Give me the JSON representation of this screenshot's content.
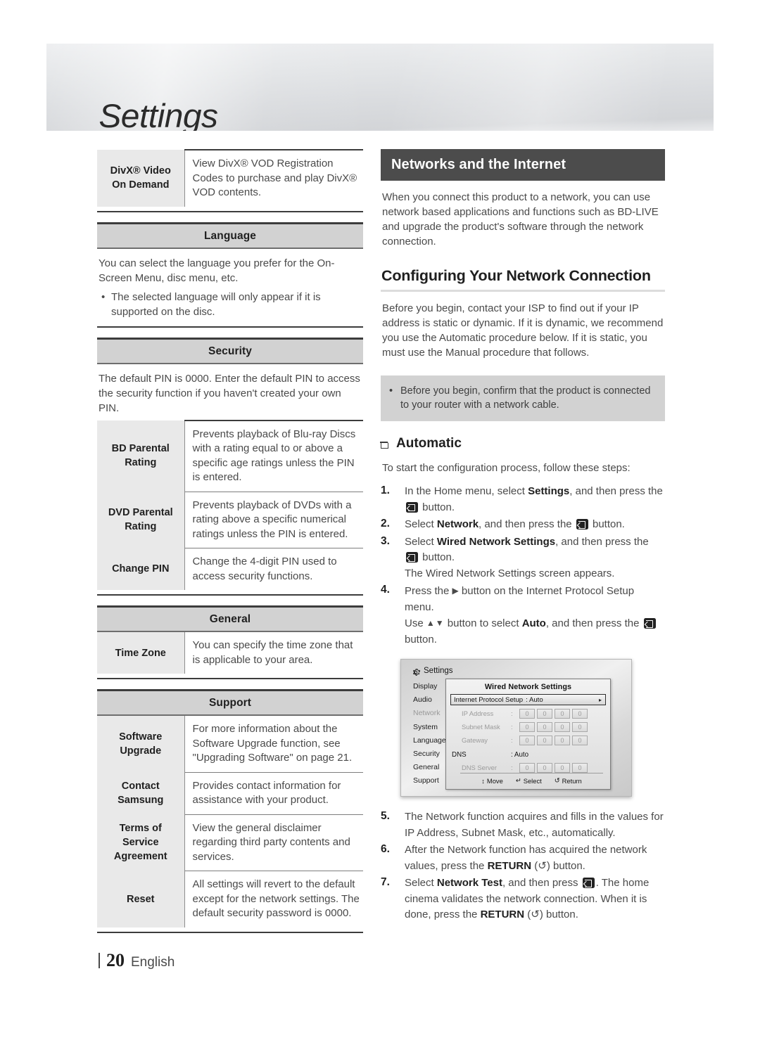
{
  "banner": {
    "title": "Settings"
  },
  "left": {
    "divx": {
      "label": "DivX® Video\nOn Demand",
      "label_l1": "DivX® Video",
      "label_l2": "On Demand",
      "desc": "View DivX® VOD Registration Codes to purchase and play DivX® VOD contents."
    },
    "language": {
      "section": "Language",
      "para": "You can select the language you prefer for the On-Screen Menu, disc menu, etc.",
      "bullet": "The selected language will only appear if it is supported on the disc.",
      "bullet_char": "•"
    },
    "security": {
      "section": "Security",
      "para": "The default PIN is 0000. Enter the default PIN to access the security function if you haven't created your own PIN.",
      "rows": [
        {
          "label_l1": "BD Parental",
          "label_l2": "Rating",
          "desc": "Prevents playback of Blu-ray Discs with a rating equal to or above a specific age ratings unless the PIN is entered."
        },
        {
          "label_l1": "DVD Parental",
          "label_l2": "Rating",
          "desc": "Prevents playback of DVDs with a rating above a specific numerical ratings unless the PIN is entered."
        },
        {
          "label_l1": "Change PIN",
          "label_l2": "",
          "desc": "Change the 4-digit PIN used to access security functions."
        }
      ]
    },
    "general": {
      "section": "General",
      "rows": [
        {
          "label_l1": "Time Zone",
          "label_l2": "",
          "desc": "You can specify the time zone that is applicable to your area."
        }
      ]
    },
    "support": {
      "section": "Support",
      "rows": [
        {
          "label_l1": "Software",
          "label_l2": "Upgrade",
          "label_l3": "",
          "desc": "For more information about the Software Upgrade function, see \"Upgrading Software\" on page 21."
        },
        {
          "label_l1": "Contact",
          "label_l2": "Samsung",
          "label_l3": "",
          "desc": "Provides contact information for assistance with your product."
        },
        {
          "label_l1": "Terms of",
          "label_l2": "Service",
          "label_l3": "Agreement",
          "desc": "View the general disclaimer regarding third party contents and services."
        },
        {
          "label_l1": "Reset",
          "label_l2": "",
          "label_l3": "",
          "desc": "All settings will revert to the default except for the network settings. The default security password is 0000."
        }
      ]
    }
  },
  "right": {
    "chapter_title": "Networks and the Internet",
    "intro": "When you connect this product to a network, you can use network based applications and functions such as BD-LIVE and upgrade the product's software through the network connection.",
    "h2": "Configuring Your Network Connection",
    "h2_para": "Before you begin, contact your ISP to find out if your IP address is static or dynamic. If it is dynamic, we recommend you use the Automatic procedure below. If it is static, you must use the Manual procedure that follows.",
    "note": {
      "bullet_char": "•",
      "text": "Before you begin, confirm that the product is connected to your router with a network cable."
    },
    "h3_automatic": "Automatic",
    "steps_intro": "To start the configuration process, follow these steps:",
    "steps": [
      {
        "num": "1.",
        "parts": [
          {
            "t": "text",
            "v": "In the Home menu, select "
          },
          {
            "t": "bold",
            "v": "Settings"
          },
          {
            "t": "text",
            "v": ", and then press the "
          },
          {
            "t": "icon",
            "v": "enter-button-icon"
          },
          {
            "t": "text",
            "v": " button."
          }
        ]
      },
      {
        "num": "2.",
        "parts": [
          {
            "t": "text",
            "v": "Select "
          },
          {
            "t": "bold",
            "v": "Network"
          },
          {
            "t": "text",
            "v": ", and then press the "
          },
          {
            "t": "icon",
            "v": "enter-button-icon"
          },
          {
            "t": "text",
            "v": " button."
          }
        ]
      },
      {
        "num": "3.",
        "parts": [
          {
            "t": "text",
            "v": "Select "
          },
          {
            "t": "bold",
            "v": "Wired Network Settings"
          },
          {
            "t": "text",
            "v": ", and then press the "
          },
          {
            "t": "icon",
            "v": "enter-button-icon"
          },
          {
            "t": "text",
            "v": " button."
          },
          {
            "t": "break",
            "v": ""
          },
          {
            "t": "text",
            "v": "The Wired Network Settings screen appears."
          }
        ]
      },
      {
        "num": "4.",
        "parts": [
          {
            "t": "text",
            "v": "Press the "
          },
          {
            "t": "icon-right",
            "v": "arrow-right-icon"
          },
          {
            "t": "text",
            "v": " button on the Internet Protocol Setup menu."
          },
          {
            "t": "break",
            "v": ""
          },
          {
            "t": "text",
            "v": "Use "
          },
          {
            "t": "icon-updown",
            "v": "arrow-up-down-icon"
          },
          {
            "t": "text",
            "v": " button to select "
          },
          {
            "t": "bold",
            "v": "Auto"
          },
          {
            "t": "text",
            "v": ", and then press the "
          },
          {
            "t": "icon",
            "v": "enter-button-icon"
          },
          {
            "t": "text",
            "v": " button."
          }
        ]
      },
      {
        "num": "5.",
        "parts": [
          {
            "t": "text",
            "v": "The Network function acquires and fills in the values for IP Address, Subnet Mask, etc., automatically."
          }
        ]
      },
      {
        "num": "6.",
        "parts": [
          {
            "t": "text",
            "v": "After the Network function has acquired the network values, press the "
          },
          {
            "t": "bold",
            "v": "RETURN"
          },
          {
            "t": "text",
            "v": " ("
          },
          {
            "t": "icon-return",
            "v": "return-arrow-icon"
          },
          {
            "t": "text",
            "v": ") button."
          }
        ]
      },
      {
        "num": "7.",
        "parts": [
          {
            "t": "text",
            "v": "Select "
          },
          {
            "t": "bold",
            "v": "Network Test"
          },
          {
            "t": "text",
            "v": ", and then press "
          },
          {
            "t": "icon",
            "v": "enter-button-icon"
          },
          {
            "t": "text",
            "v": ". The home cinema validates the network connection. When it is done, press the "
          },
          {
            "t": "bold",
            "v": "RETURN"
          },
          {
            "t": "text",
            "v": " ("
          },
          {
            "t": "icon-return",
            "v": "return-arrow-icon"
          },
          {
            "t": "text",
            "v": ") button."
          }
        ]
      }
    ]
  },
  "tv_screenshot": {
    "settings_label": "Settings",
    "menu_items": [
      {
        "label": "Display",
        "dim": false
      },
      {
        "label": "Audio",
        "dim": false
      },
      {
        "label": "Network",
        "dim": true
      },
      {
        "label": "System",
        "dim": false
      },
      {
        "label": "Language",
        "dim": false
      },
      {
        "label": "Security",
        "dim": false
      },
      {
        "label": "General",
        "dim": false
      },
      {
        "label": "Support",
        "dim": false
      }
    ],
    "dialog_title": "Wired Network Settings",
    "ip_setup": {
      "label": "Internet Protocol Setup",
      "value": ": Auto",
      "arrow": "▸"
    },
    "fields": [
      {
        "name": "IP Address",
        "colon": ":",
        "boxes": [
          "0",
          "0",
          "0",
          "0"
        ]
      },
      {
        "name": "Subnet Mask",
        "colon": ":",
        "boxes": [
          "0",
          "0",
          "0",
          "0"
        ]
      },
      {
        "name": "Gateway",
        "colon": ":",
        "boxes": [
          "0",
          "0",
          "0",
          "0"
        ]
      }
    ],
    "dns_row": {
      "name": "DNS",
      "value": ": Auto"
    },
    "dns_server": {
      "name": "DNS Server",
      "colon": ":",
      "boxes": [
        "0",
        "0",
        "0",
        "0"
      ]
    },
    "footer": [
      {
        "icon": "updown-arrow-icon",
        "glyph": "↕",
        "label": "Move"
      },
      {
        "icon": "enter-icon",
        "glyph": "↵",
        "label": "Select"
      },
      {
        "icon": "return-icon",
        "glyph": "↺",
        "label": "Return"
      }
    ]
  },
  "footer": {
    "page": "20",
    "language": "English"
  },
  "colors": {
    "chapter_bar": "#4c4c4c",
    "section_bar": "#d2d2d2",
    "label_cell": "#e9e9e9",
    "note_box": "#d2d2d2",
    "body_text": "#4a4a4a",
    "heading_text": "#1f1f1f"
  }
}
